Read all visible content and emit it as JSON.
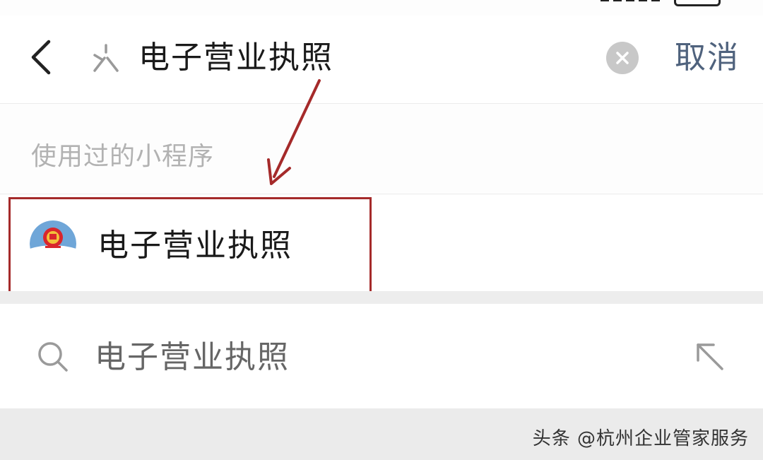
{
  "header": {
    "search_query": "电子营业执照",
    "cancel_label": "取消"
  },
  "section": {
    "label": "使用过的小程序"
  },
  "result": {
    "app_name": "电子营业执照",
    "logo_text": "电子营业执照"
  },
  "suggestion": {
    "text": "电子营业执照"
  },
  "watermark": {
    "text": "头条 @杭州企业管家服务"
  },
  "colors": {
    "accent_cancel": "#4f627d",
    "highlight_border": "#a52a2a",
    "annotation_arrow": "#a52a2a"
  },
  "icons": {
    "back": "chevron-left-icon",
    "search_mini": "search-icon",
    "clear": "close-circle-icon",
    "suggest_search": "magnifier-icon",
    "fill": "arrow-up-left-icon"
  }
}
